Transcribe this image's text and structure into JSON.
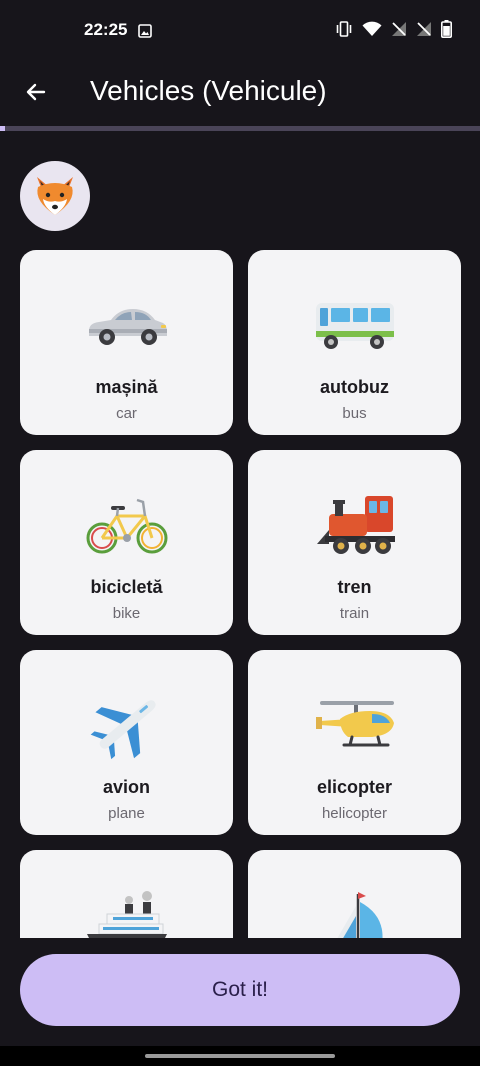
{
  "status_bar": {
    "time": "22:25",
    "icons": [
      "image-icon",
      "vibrate-icon",
      "wifi-icon",
      "no-signal-icon",
      "no-signal-icon",
      "battery-icon"
    ]
  },
  "header": {
    "title": "Vehicles (Vehicule)",
    "back_icon": "arrow-left-icon"
  },
  "progress": {
    "fraction": 0.01
  },
  "avatar": {
    "icon": "fox-icon"
  },
  "cards": [
    {
      "word": "mașină",
      "translation": "car",
      "icon": "car-icon"
    },
    {
      "word": "autobuz",
      "translation": "bus",
      "icon": "bus-icon"
    },
    {
      "word": "bicicletă",
      "translation": "bike",
      "icon": "bicycle-icon"
    },
    {
      "word": "tren",
      "translation": "train",
      "icon": "locomotive-icon"
    },
    {
      "word": "avion",
      "translation": "plane",
      "icon": "airplane-icon"
    },
    {
      "word": "elicopter",
      "translation": "helicopter",
      "icon": "helicopter-icon"
    },
    {
      "word": "",
      "translation": "",
      "icon": "ship-icon"
    },
    {
      "word": "",
      "translation": "",
      "icon": "sailboat-icon"
    }
  ],
  "actions": {
    "primary_label": "Got it!"
  },
  "colors": {
    "background": "#17151b",
    "accent": "#cdbdf5",
    "card": "#f4f4f6"
  }
}
